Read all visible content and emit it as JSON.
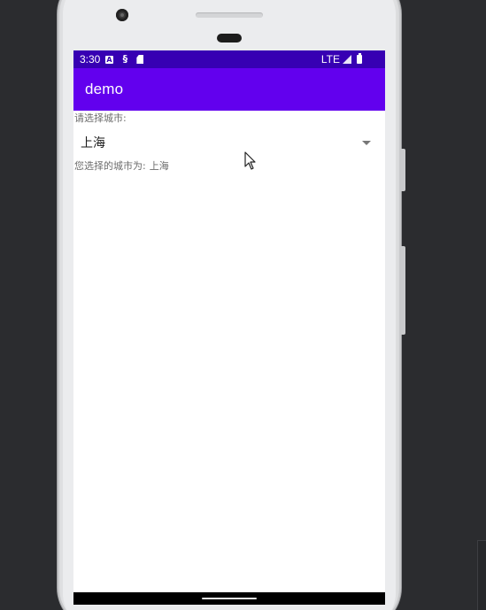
{
  "status_bar": {
    "time": "3:30",
    "icons": [
      "notification-a-icon",
      "debug-icon",
      "sd-card-icon"
    ],
    "network": "LTE",
    "right_icons": [
      "signal-icon",
      "battery-icon"
    ]
  },
  "app_bar": {
    "title": "demo"
  },
  "form": {
    "prompt": "请选择城市:",
    "spinner_value": "上海",
    "result_label": "您选择的城市为:",
    "result_value": "上海"
  },
  "colors": {
    "status_bar": "#3700b3",
    "app_bar": "#6200ee"
  }
}
